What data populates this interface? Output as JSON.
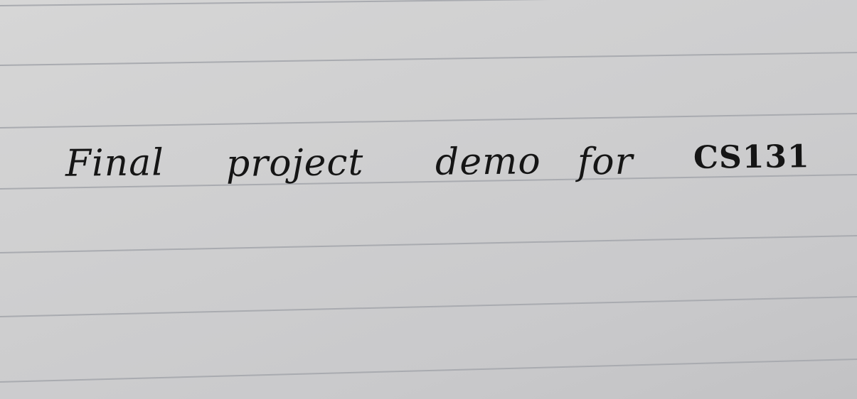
{
  "note": {
    "words": [
      "Final",
      "project",
      "demo",
      "for",
      "CS131"
    ],
    "ink_color": "#151515",
    "paper_color": "#d0d0d2",
    "rule_color": "#a9abb0"
  }
}
